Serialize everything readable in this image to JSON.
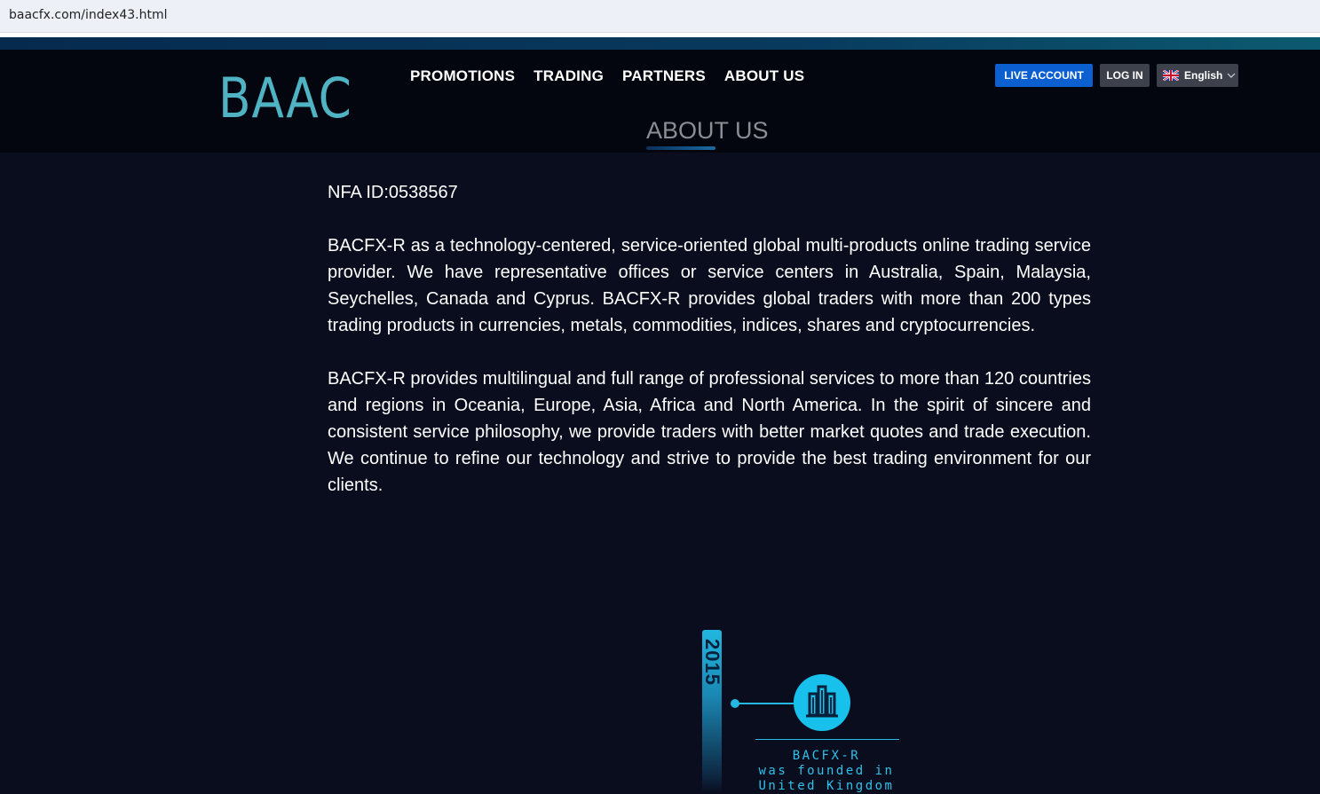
{
  "browser": {
    "url": "baacfx.com/index43.html"
  },
  "header": {
    "logo": "BAAC",
    "nav": [
      "PROMOTIONS",
      "TRADING",
      "PARTNERS",
      "ABOUT US"
    ],
    "live_account": "LIVE ACCOUNT",
    "login": "LOG IN",
    "language": "English",
    "accent_color": "#0b5fd0",
    "logo_color": "#4fb3c3"
  },
  "section": {
    "title": "ABOUT US"
  },
  "content": {
    "nfa": "NFA ID:0538567",
    "paragraphs": [
      "BACFX-R as a technology-centered, service-oriented global multi-products online trading service provider. We have representative offices or service centers in Australia, Spain, Malaysia, Seychelles, Canada and Cyprus. BACFX-R provides global traders with more than 200 types trading products in currencies, metals, commodities, indices, shares and cryptocurrencies.",
      "BACFX-R provides multilingual and full range of professional services to more than 120 countries and regions in Oceania, Europe, Asia, Africa and North America. In the spirit of sincere and consistent service philosophy, we provide traders with better market quotes and trade execution. We continue to refine our technology and strive to provide the best trading environment for our clients."
    ]
  },
  "timeline": {
    "year": "2015",
    "line1": "BACFX-R",
    "line2": "was founded in",
    "line3": "United Kingdom",
    "icon": "building-icon",
    "color": "#17c1ec"
  }
}
